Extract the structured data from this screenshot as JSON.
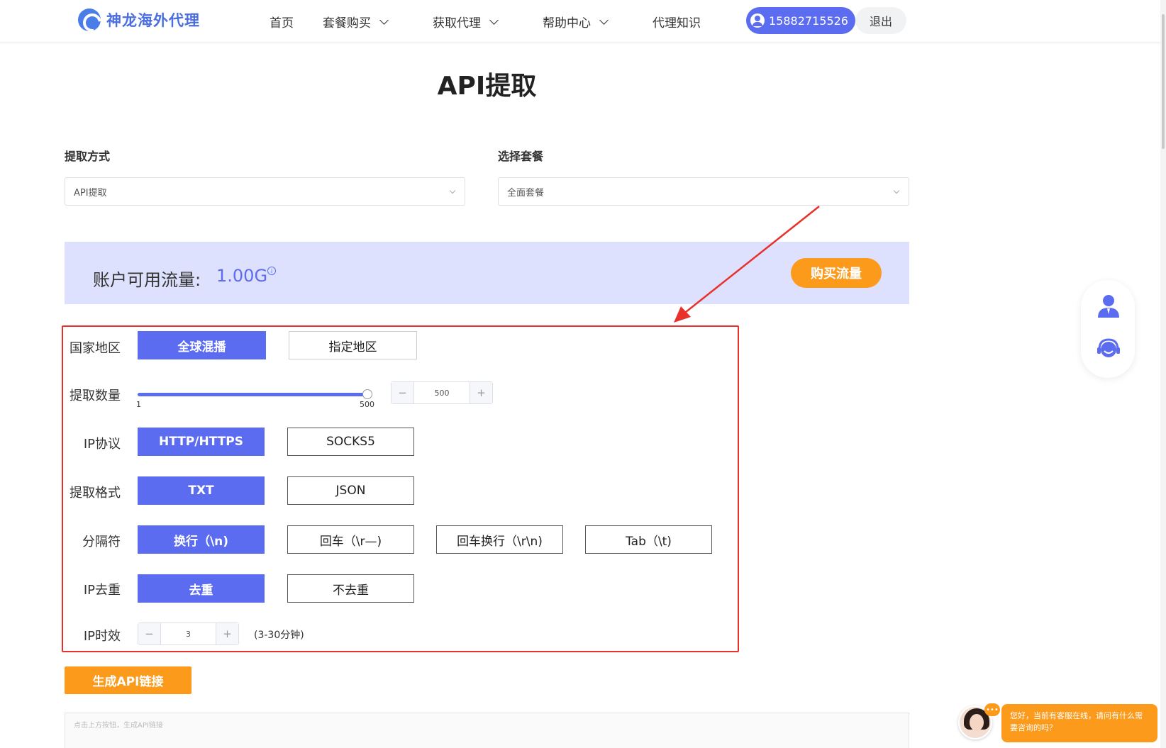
{
  "header": {
    "logo_text": "神龙海外代理",
    "nav": [
      {
        "label": "首页",
        "has_menu": false
      },
      {
        "label": "套餐购买",
        "has_menu": true
      },
      {
        "label": "获取代理",
        "has_menu": true
      },
      {
        "label": "帮助中心",
        "has_menu": true
      },
      {
        "label": "代理知识",
        "has_menu": false
      }
    ],
    "user_phone": "15882715526",
    "logout_label": "退出"
  },
  "page_title": "API提取",
  "extract_method": {
    "label": "提取方式",
    "value": "API提取"
  },
  "package": {
    "label": "选择套餐",
    "value": "全面套餐"
  },
  "flow": {
    "label": "账户可用流量:",
    "value": "1.00G",
    "info_icon": "info-circle-icon",
    "buy_label": "购买流量"
  },
  "form": {
    "region": {
      "label": "国家地区",
      "options": [
        "全球混播",
        "指定地区"
      ],
      "selected": 0
    },
    "quantity": {
      "label": "提取数量",
      "min_label": "1",
      "max_label": "500",
      "value": "500",
      "level": 1.0
    },
    "protocol": {
      "label": "IP协议",
      "options": [
        "HTTP/HTTPS",
        "SOCKS5"
      ],
      "selected": 0
    },
    "format": {
      "label": "提取格式",
      "options": [
        "TXT",
        "JSON"
      ],
      "selected": 0
    },
    "separator": {
      "label": "分隔符",
      "options": [
        "换行（\\n)",
        "回车（\\r—)",
        "回车换行（\\r\\n)",
        "Tab（\\t)"
      ],
      "selected": 0
    },
    "dedupe": {
      "label": "IP去重",
      "options": [
        "去重",
        "不去重"
      ],
      "selected": 0
    },
    "ttl": {
      "label": "IP时效",
      "value": "3",
      "hint": "(3-30分钟)"
    }
  },
  "generate_label": "生成API链接",
  "result_placeholder": "点击上方按钮，生成API链接",
  "chat": {
    "dots": "•••",
    "message": "您好，当前有客服在线，请问有什么需要咨询的吗？"
  },
  "colors": {
    "primary": "#5b6cf0",
    "accent": "#fb9a1b",
    "banner": "#dde1fd",
    "annotation": "#e8312b"
  }
}
